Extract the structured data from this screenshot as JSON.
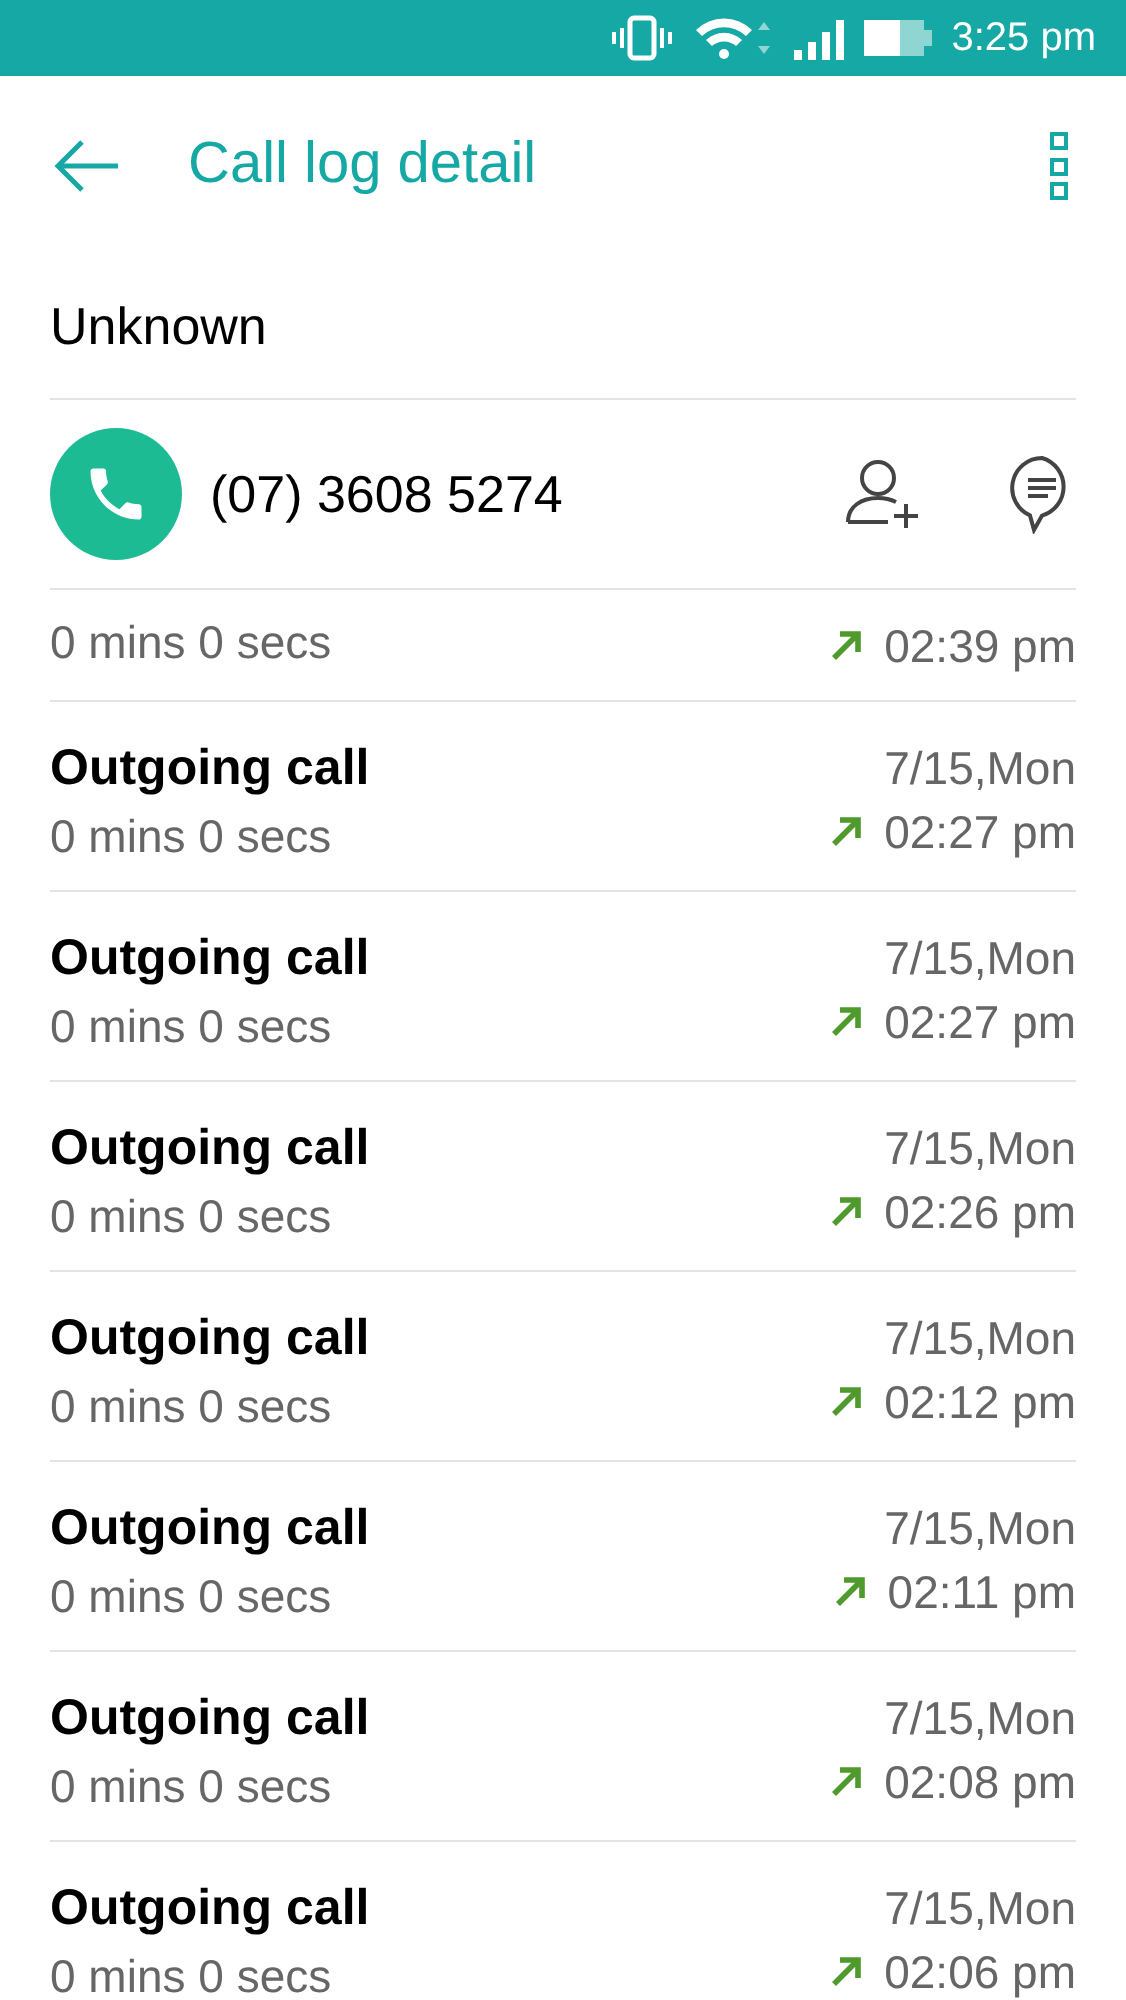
{
  "status_bar": {
    "time": "3:25 pm"
  },
  "header": {
    "title": "Call log detail"
  },
  "contact": {
    "name": "Unknown",
    "number": "(07) 3608 5274"
  },
  "calls": [
    {
      "duration": "0 mins 0 secs",
      "time": "02:39 pm",
      "kind": "outgoing"
    },
    {
      "title": "Outgoing call",
      "duration": "0 mins 0 secs",
      "date": "7/15,Mon",
      "time": "02:27 pm",
      "kind": "outgoing"
    },
    {
      "title": "Outgoing call",
      "duration": "0 mins 0 secs",
      "date": "7/15,Mon",
      "time": "02:27 pm",
      "kind": "outgoing"
    },
    {
      "title": "Outgoing call",
      "duration": "0 mins 0 secs",
      "date": "7/15,Mon",
      "time": "02:26 pm",
      "kind": "outgoing"
    },
    {
      "title": "Outgoing call",
      "duration": "0 mins 0 secs",
      "date": "7/15,Mon",
      "time": "02:12 pm",
      "kind": "outgoing"
    },
    {
      "title": "Outgoing call",
      "duration": "0 mins 0 secs",
      "date": "7/15,Mon",
      "time": "02:11 pm",
      "kind": "outgoing"
    },
    {
      "title": "Outgoing call",
      "duration": "0 mins 0 secs",
      "date": "7/15,Mon",
      "time": "02:08 pm",
      "kind": "outgoing"
    },
    {
      "title": "Outgoing call",
      "duration": "0 mins 0 secs",
      "date": "7/15,Mon",
      "time": "02:06 pm",
      "kind": "outgoing"
    }
  ]
}
